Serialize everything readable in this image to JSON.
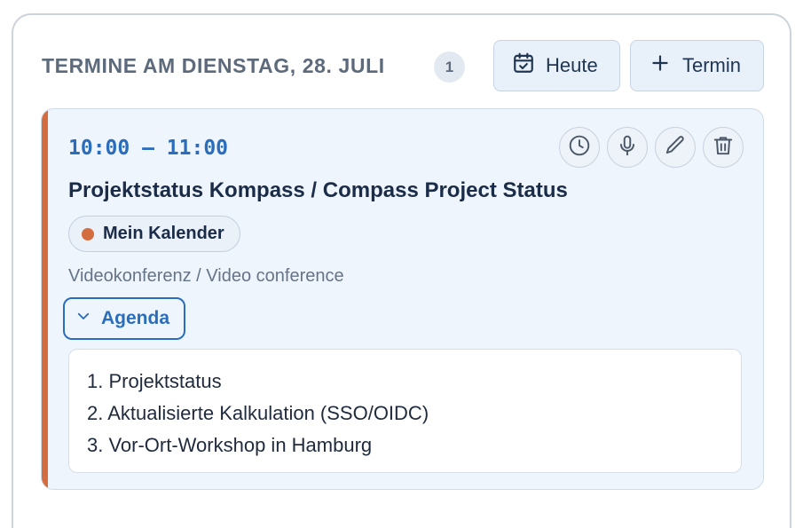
{
  "header": {
    "title": "TERMINE AM DIENSTAG, 28. JULI",
    "count": "1",
    "today_label": "Heute",
    "new_label": "Termin"
  },
  "event": {
    "time": "10:00 – 11:00",
    "title": "Projektstatus Kompass / Compass Project Status",
    "calendar": "Mein Kalender",
    "location": "Videokonferenz / Video conference",
    "agenda_label": "Agenda",
    "agenda_items": [
      "1. Projektstatus",
      "2. Aktualisierte Kalkulation (SSO/OIDC)",
      "3. Vor-Ort-Workshop in Hamburg"
    ],
    "actions": [
      "clock-icon",
      "microphone-icon",
      "pencil-icon",
      "trash-icon"
    ]
  },
  "colors": {
    "accent": "#d36c3f",
    "link_blue": "#2a6dbd",
    "card_background": "#eff5fc"
  }
}
